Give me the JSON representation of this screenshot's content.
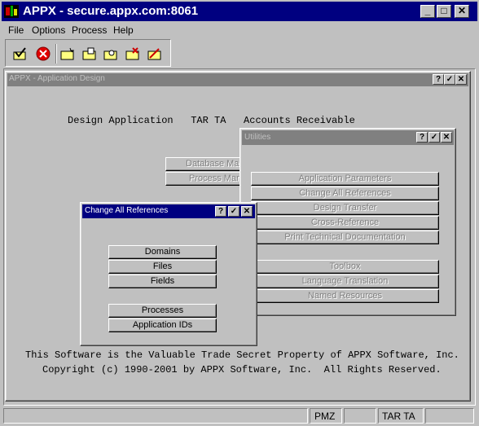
{
  "window": {
    "title": "APPX - secure.appx.com:8061",
    "min": "_",
    "max": "□",
    "close": "✕"
  },
  "menu": [
    {
      "label": "File"
    },
    {
      "label": "Options"
    },
    {
      "label": "Process"
    },
    {
      "label": "Help"
    }
  ],
  "toolbar": [
    "check-folder-icon",
    "stop-icon",
    "folder-new-icon",
    "folder-up-icon",
    "folder-search-icon",
    "folder-delete-icon",
    "folder-cancel-icon"
  ],
  "app_design": {
    "title": "APPX - Application Design",
    "header_line": "Design Application   TAR TA   Accounts Receivable",
    "partial_buttons": [
      "Database Man",
      "Process Man"
    ],
    "footer_line1": "This Software is the Valuable Trade Secret Property of APPX Software, Inc.",
    "footer_line2": "Copyright (c) 1990-2001 by APPX Software, Inc.  All Rights Reserved."
  },
  "utilities": {
    "title": "Utilities",
    "items": [
      "Application Parameters",
      "Change All References",
      "Design Transfer",
      "Cross-Reference",
      "Print Technical Documentation",
      "Toolbox",
      "Language Translation",
      "Named Resources"
    ]
  },
  "change_refs": {
    "title": "Change All References",
    "items": [
      "Domains",
      "Files",
      "Fields",
      "Processes",
      "Application IDs"
    ]
  },
  "status": {
    "cell1": "PMZ",
    "cell2": "TAR TA"
  },
  "colors": {
    "titlebar": "#000080",
    "inactive_title": "#808080",
    "face": "#c0c0c0"
  }
}
